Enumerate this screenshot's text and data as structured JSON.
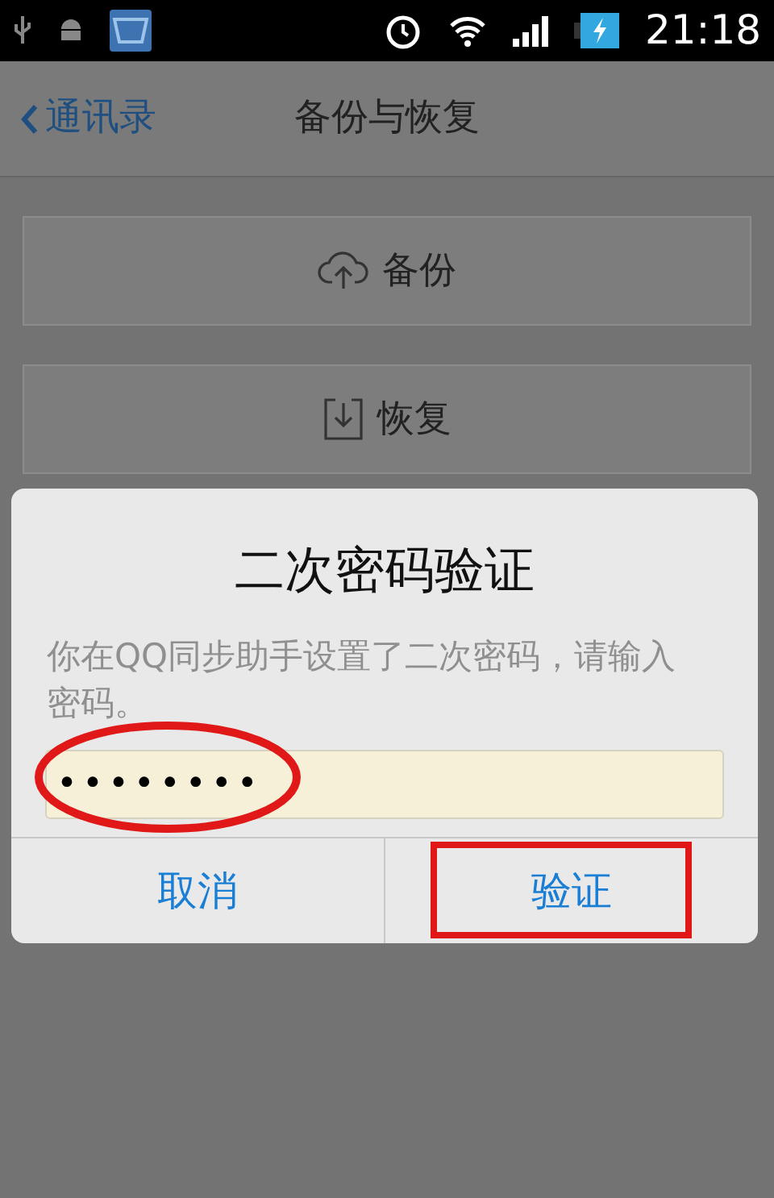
{
  "status_bar": {
    "time": "21:18"
  },
  "header": {
    "back_label": "通讯录",
    "title": "备份与恢复"
  },
  "actions": [
    {
      "kind": "backup",
      "label": "备份"
    },
    {
      "kind": "restore",
      "label": "恢复"
    }
  ],
  "dialog": {
    "title": "二次密码验证",
    "message": "你在QQ同步助手设置了二次密码，请输入密码。",
    "password": {
      "value": "••••••••",
      "circled": true
    },
    "buttons": [
      {
        "label": "取消",
        "boxed": false
      },
      {
        "label": "验证",
        "boxed": true
      }
    ]
  }
}
